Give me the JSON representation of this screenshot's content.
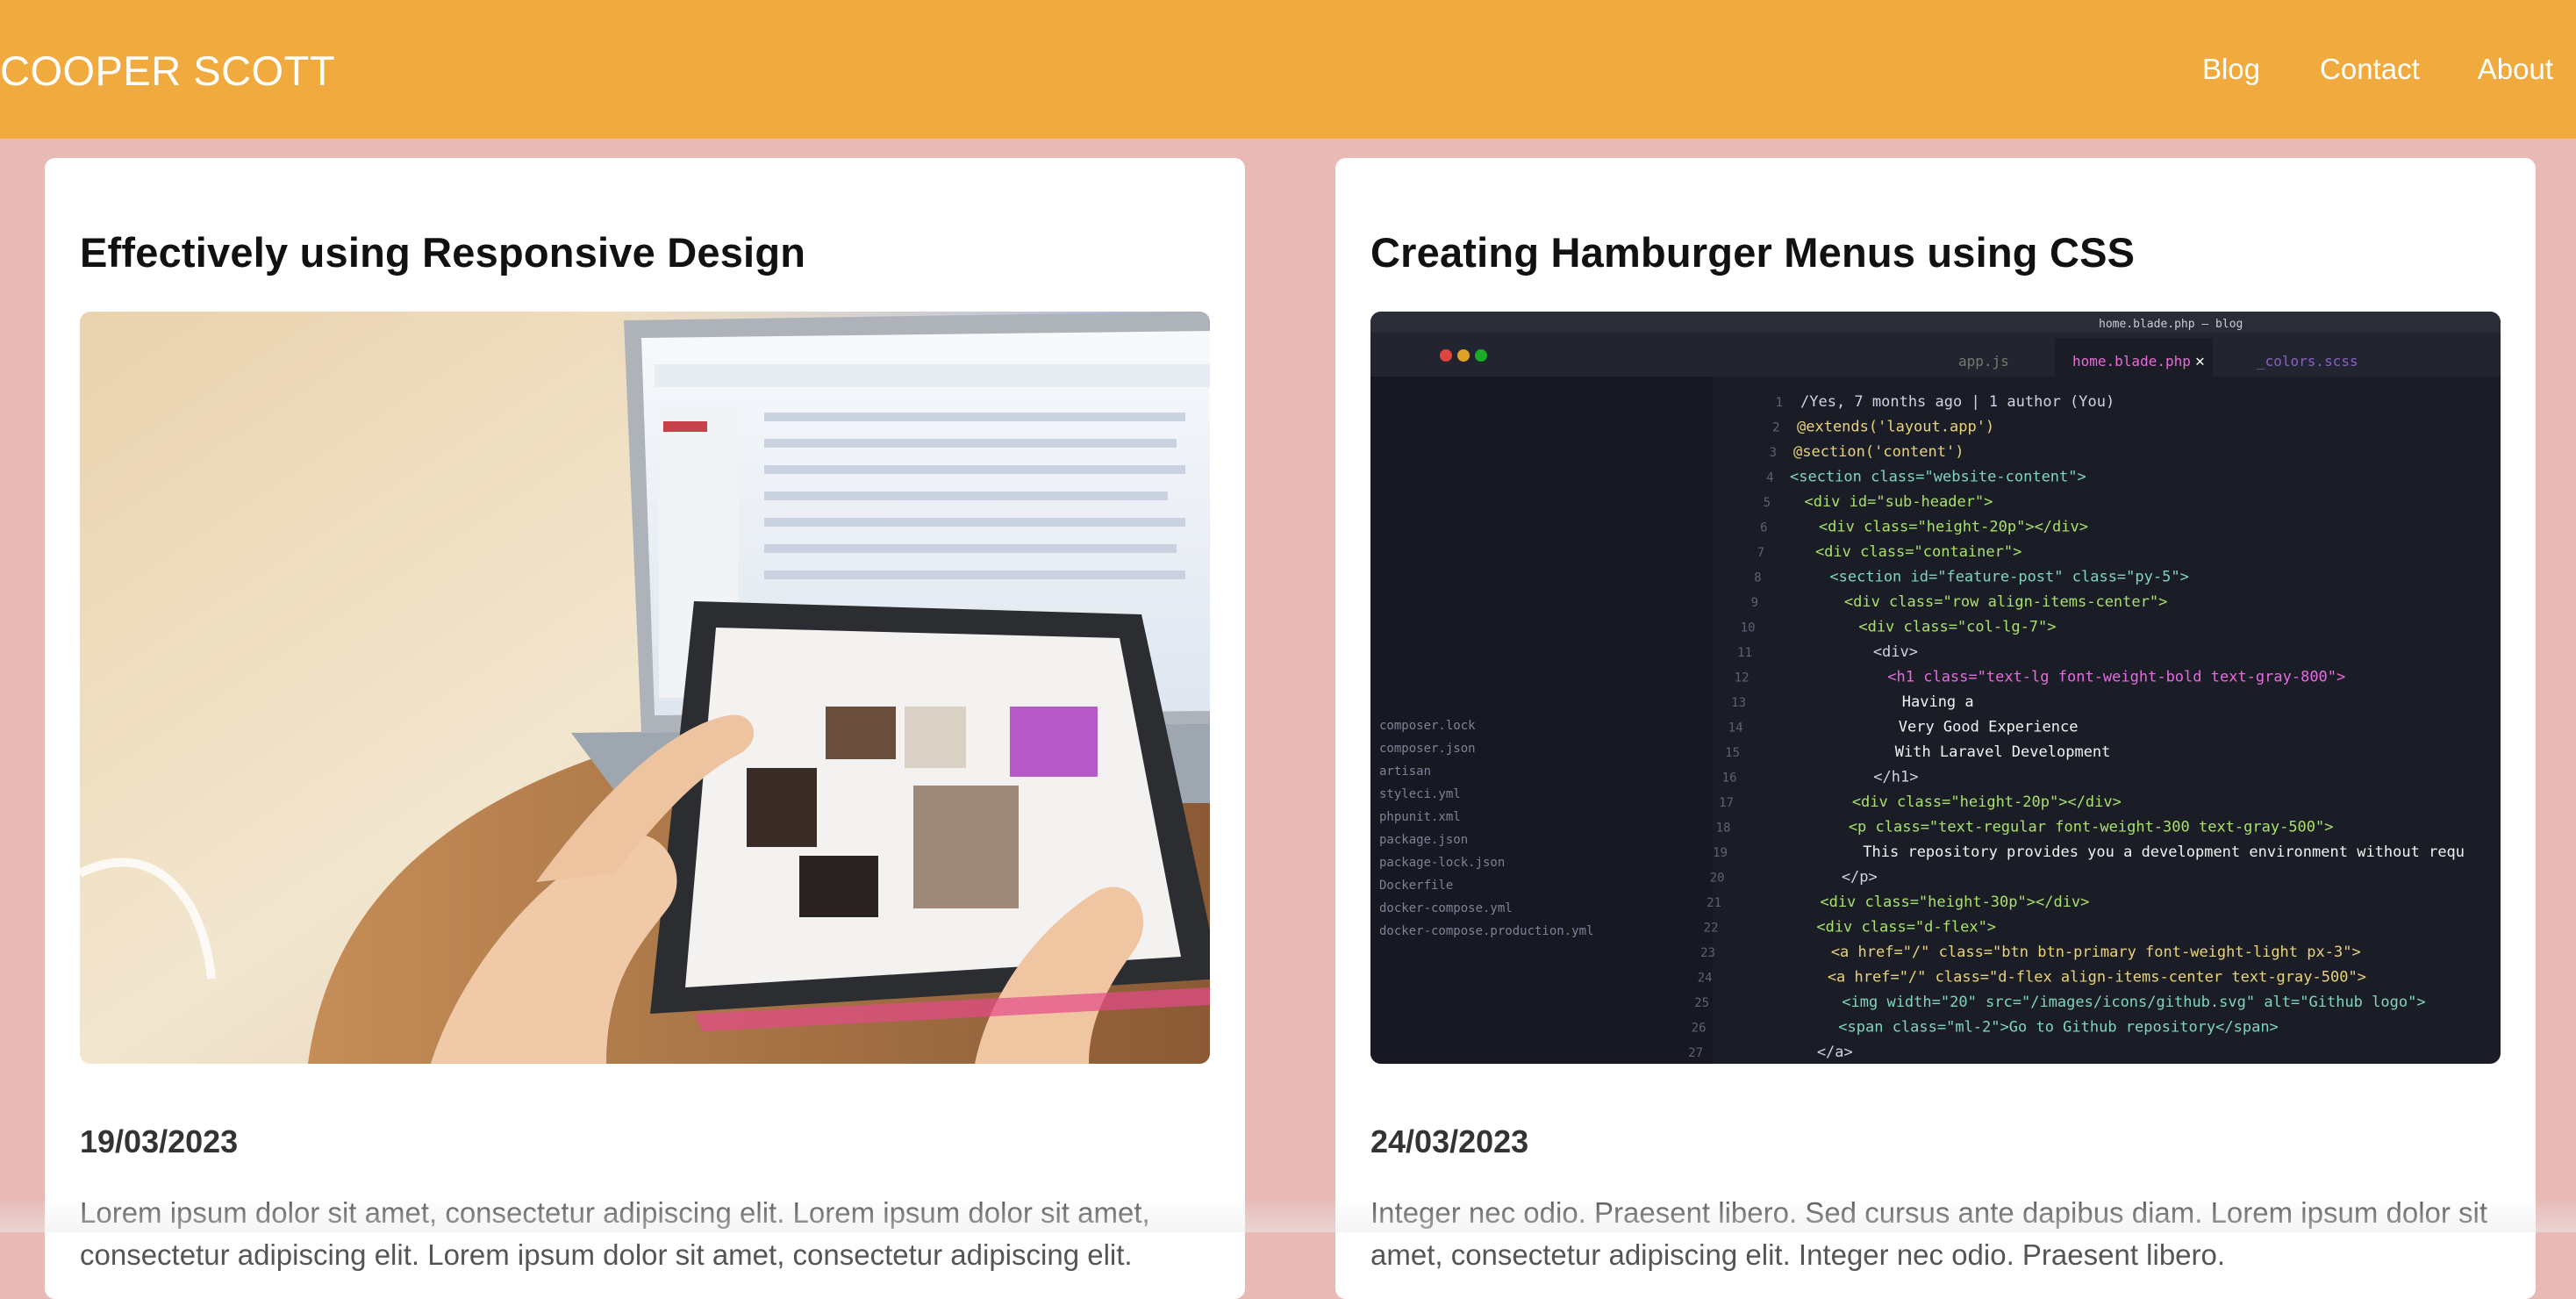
{
  "header": {
    "brand": "COOPER SCOTT",
    "nav": {
      "blog": "Blog",
      "contact": "Contact",
      "about": "About"
    }
  },
  "posts": [
    {
      "title": "Effectively using Responsive Design",
      "image_alt": "Hands using a tablet in front of a laptop",
      "date": "19/03/2023",
      "excerpt": "Lorem ipsum dolor sit amet, consectetur adipiscing elit. Lorem ipsum dolor sit amet, consectetur adipiscing elit. Lorem ipsum dolor sit amet, consectetur adipiscing elit."
    },
    {
      "title": "Creating Hamburger Menus using CSS",
      "image_alt": "Code editor showing HTML markup",
      "date": "24/03/2023",
      "excerpt": "Integer nec odio. Praesent libero. Sed cursus ante dapibus diam. Lorem ipsum dolor sit amet, consectetur adipiscing elit. Integer nec odio. Praesent libero."
    }
  ],
  "editor": {
    "tabs": [
      "home.blade.php",
      "_colors.scss",
      "app.js"
    ],
    "window_title": "home.blade.php — blog",
    "line_numbers": [
      "1",
      "2",
      "3",
      "4",
      "5",
      "6",
      "7",
      "8",
      "9",
      "10",
      "11",
      "12",
      "13",
      "14",
      "15",
      "16",
      "17",
      "18",
      "19",
      "20",
      "21",
      "22",
      "23",
      "24",
      "25",
      "26",
      "27"
    ],
    "lines": [
      "/Yes, 7 months ago | 1 author (You)",
      "@extends('layout.app')",
      "@section('content')",
      "<section class=\"website-content\">",
      "  <div id=\"sub-header\">",
      "    <div class=\"height-20p\"></div>",
      "    <div class=\"container\">",
      "      <section id=\"feature-post\" class=\"py-5\">",
      "        <div class=\"row align-items-center\">",
      "          <div class=\"col-lg-7\">",
      "            <div>",
      "              <h1 class=\"text-lg font-weight-bold text-gray-800\">",
      "                Having a",
      "                Very Good Experience",
      "                With Laravel Development",
      "              </h1>",
      "            <div class=\"height-20p\"></div>",
      "            <p class=\"text-regular font-weight-300 text-gray-500\">",
      "              This repository provides you a development environment without requ",
      "            </p>",
      "          <div class=\"height-30p\"></div>",
      "          <div class=\"d-flex\">",
      "            <a href=\"/\" class=\"btn btn-primary font-weight-light px-3\">",
      "            <a href=\"/\" class=\"d-flex align-items-center text-gray-500\">",
      "              <img width=\"20\" src=\"/images/icons/github.svg\" alt=\"Github logo\">",
      "              <span class=\"ml-2\">Go to Github repository</span>",
      "            </a>"
    ],
    "sidebar_files": [
      "docker-compose.production.yml",
      "docker-compose.yml",
      "Dockerfile",
      "package-lock.json",
      "package.json",
      "phpunit.xml",
      "styleci.yml",
      "artisan",
      "composer.json",
      "composer.lock"
    ]
  },
  "colors": {
    "header_bg": "#f1aa3d",
    "page_bg": "#e8b9b5",
    "card_bg": "#ffffff"
  }
}
